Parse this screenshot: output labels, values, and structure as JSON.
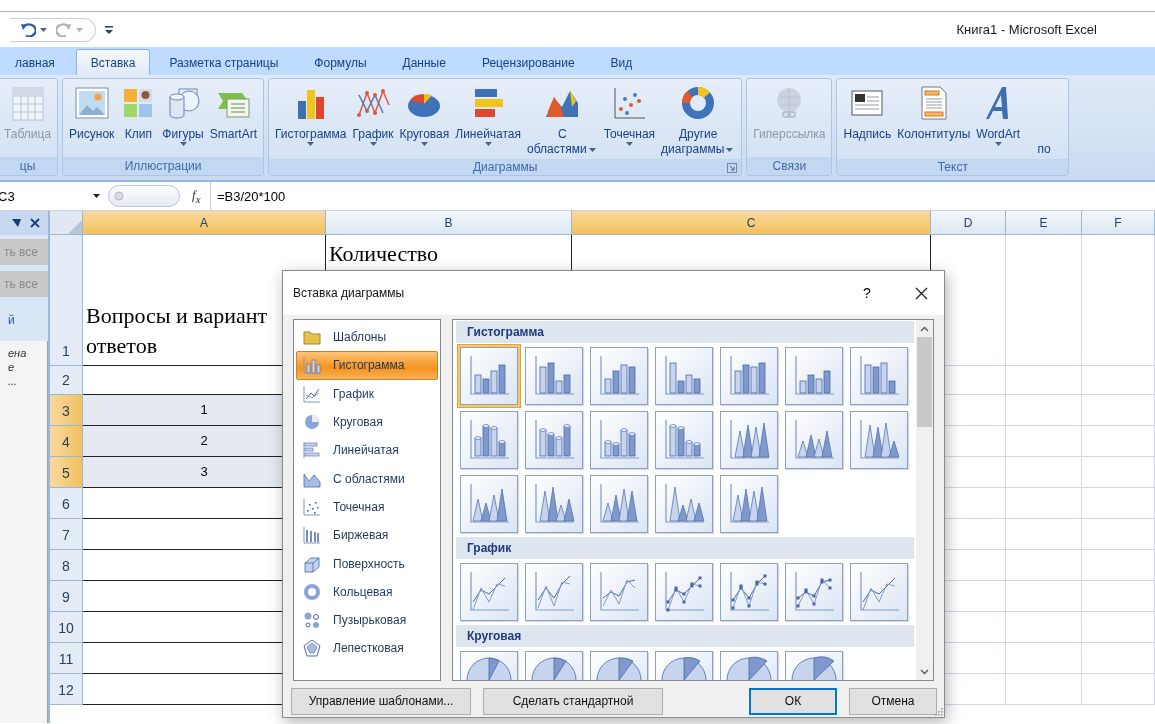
{
  "title_bar": {
    "title": "Книга1 - Microsoft Excel",
    "quick_access": [
      {
        "kind": "undo",
        "disabled": false
      },
      {
        "kind": "redo",
        "disabled": true
      }
    ]
  },
  "tabs": [
    {
      "label": "лавная",
      "selected": false
    },
    {
      "label": "Вставка",
      "selected": true
    },
    {
      "label": "Разметка страницы",
      "selected": false
    },
    {
      "label": "Формулы",
      "selected": false
    },
    {
      "label": "Данные",
      "selected": false
    },
    {
      "label": "Рецензирование",
      "selected": false
    },
    {
      "label": "Вид",
      "selected": false
    }
  ],
  "ribbon": {
    "groups": [
      {
        "label": "цы",
        "buttons": [
          {
            "label": "Таблица",
            "kind": "table",
            "disabled": true
          }
        ]
      },
      {
        "label": "Иллюстрации",
        "buttons": [
          {
            "label": "Рисунок",
            "kind": "picture",
            "disabled": false
          },
          {
            "label": "Клип",
            "kind": "clip",
            "disabled": false
          },
          {
            "label": "Фигуры",
            "kind": "shapes",
            "disabled": false,
            "dropdown": true
          },
          {
            "label": "SmartArt",
            "kind": "smartart",
            "disabled": false
          }
        ]
      },
      {
        "label": "Диаграммы",
        "launcher": true,
        "buttons": [
          {
            "label": "Гистограмма",
            "kind": "column",
            "disabled": false,
            "dropdown": true
          },
          {
            "label": "График",
            "kind": "line",
            "disabled": false,
            "dropdown": true
          },
          {
            "label": "Круговая",
            "kind": "pie",
            "disabled": false,
            "dropdown": true
          },
          {
            "label": "Линейчатая",
            "kind": "bar",
            "disabled": false,
            "dropdown": true
          },
          {
            "label": "С\nобластями",
            "kind": "area",
            "disabled": false,
            "dropdown": true
          },
          {
            "label": "Точечная",
            "kind": "scatter",
            "disabled": false,
            "dropdown": true
          },
          {
            "label": "Другие\nдиаграммы",
            "kind": "doughnut",
            "disabled": false,
            "dropdown": true
          }
        ]
      },
      {
        "label": "Связи",
        "buttons": [
          {
            "label": "Гиперссылка",
            "kind": "globe",
            "disabled": true
          }
        ]
      },
      {
        "label": "Текст",
        "buttons": [
          {
            "label": "Надпись",
            "kind": "textbox",
            "disabled": false
          },
          {
            "label": "Колонтитулы",
            "kind": "header_footer",
            "disabled": false
          },
          {
            "label": "WordArt",
            "kind": "wordart",
            "disabled": false,
            "dropdown": true
          },
          {
            "label": "по",
            "kind": "partial",
            "disabled": false
          }
        ]
      }
    ]
  },
  "formula_bar": {
    "name_box": "C3",
    "function_label": "f$_{x}$",
    "formula": "=B3/20*100"
  },
  "task_pane": {
    "buttons": [
      "ть все",
      "ть все"
    ],
    "heading": "й",
    "items": [
      "ена",
      "е",
      "..."
    ]
  },
  "sheet": {
    "columns": [
      {
        "label": "A",
        "selected": true
      },
      {
        "label": "B",
        "selected": false
      },
      {
        "label": "C",
        "selected": true
      },
      {
        "label": "D",
        "selected": false
      },
      {
        "label": "E",
        "selected": false
      },
      {
        "label": "F",
        "selected": false
      }
    ],
    "rows": [
      {
        "header": "1",
        "selected": false,
        "kind": "heading",
        "a": "Вопросы и вариант\nответов",
        "b": "Количество"
      },
      {
        "header": "2",
        "selected": false
      },
      {
        "header": "3",
        "selected": true,
        "a": "1"
      },
      {
        "header": "4",
        "selected": true,
        "a": "2"
      },
      {
        "header": "5",
        "selected": true,
        "a": "3"
      },
      {
        "header": "6",
        "selected": false
      },
      {
        "header": "7",
        "selected": false
      },
      {
        "header": "8",
        "selected": false
      },
      {
        "header": "9",
        "selected": false
      },
      {
        "header": "10",
        "selected": false
      },
      {
        "header": "11",
        "selected": false
      },
      {
        "header": "12",
        "selected": false
      }
    ]
  },
  "dialog": {
    "title": "Вставка диаграммы",
    "help": "?",
    "categories": [
      {
        "label": "Шаблоны",
        "kind": "folder",
        "selected": false
      },
      {
        "label": "Гистограмма",
        "kind": "column",
        "selected": true
      },
      {
        "label": "График",
        "kind": "line",
        "selected": false
      },
      {
        "label": "Круговая",
        "kind": "pie",
        "selected": false
      },
      {
        "label": "Линейчатая",
        "kind": "bar",
        "selected": false
      },
      {
        "label": "С областями",
        "kind": "area",
        "selected": false
      },
      {
        "label": "Точечная",
        "kind": "scatter",
        "selected": false
      },
      {
        "label": "Биржевая",
        "kind": "stock",
        "selected": false
      },
      {
        "label": "Поверхность",
        "kind": "surface",
        "selected": false
      },
      {
        "label": "Кольцевая",
        "kind": "doughnut",
        "selected": false
      },
      {
        "label": "Пузырьковая",
        "kind": "bubble",
        "selected": false
      },
      {
        "label": "Лепестковая",
        "kind": "radar",
        "selected": false
      }
    ],
    "sections": [
      {
        "title": "Гистограмма",
        "kind": "column",
        "options": [
          {
            "selected": true
          },
          {
            "selected": false
          },
          {
            "selected": false
          },
          {
            "selected": false
          },
          {
            "selected": false
          },
          {
            "selected": false
          },
          {
            "selected": false
          },
          {
            "selected": false
          },
          {
            "selected": false
          },
          {
            "selected": false
          },
          {
            "selected": false
          },
          {
            "selected": false
          },
          {
            "selected": false
          },
          {
            "selected": false
          },
          {
            "selected": false
          },
          {
            "selected": false
          },
          {
            "selected": false
          },
          {
            "selected": false
          },
          {
            "selected": false
          }
        ]
      },
      {
        "title": "График",
        "kind": "line",
        "options": [
          {
            "selected": false
          },
          {
            "selected": false
          },
          {
            "selected": false
          },
          {
            "selected": false
          },
          {
            "selected": false
          },
          {
            "selected": false
          },
          {
            "selected": false
          }
        ]
      },
      {
        "title": "Круговая",
        "kind": "pie",
        "options": [
          {
            "selected": false
          },
          {
            "selected": false
          },
          {
            "selected": false
          },
          {
            "selected": false
          },
          {
            "selected": false
          },
          {
            "selected": false
          }
        ]
      }
    ],
    "buttons": [
      {
        "label": "Управление шаблонами...",
        "default": false
      },
      {
        "label": "Сделать стандартной",
        "default": false
      },
      {
        "label": "ОК",
        "default": true
      },
      {
        "label": "Отмена",
        "default": false
      }
    ]
  }
}
